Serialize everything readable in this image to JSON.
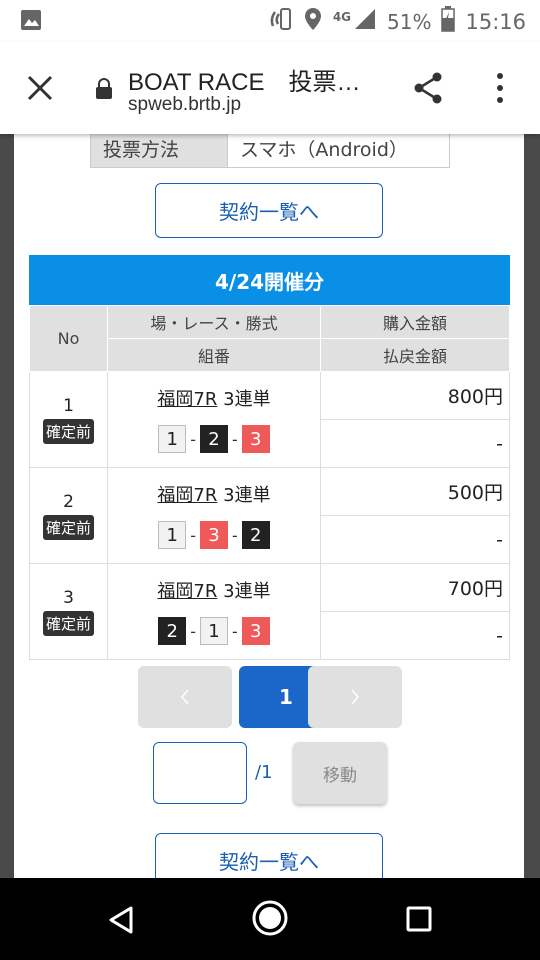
{
  "status_bar": {
    "network": "4G",
    "battery": "51%",
    "time": "15:16"
  },
  "app_bar": {
    "title": "BOAT RACE　投票…",
    "url": "spweb.brtb.jp"
  },
  "vote_method": {
    "label": "投票方法",
    "value": "スマホ（Android）"
  },
  "contract_list_button": "契約一覧へ",
  "date_header": "4/24開催分",
  "table": {
    "headers": {
      "no": "No",
      "race": "場・レース・勝式",
      "purchase": "購入金額",
      "combo": "組番",
      "payout": "払戻金額"
    },
    "rows": [
      {
        "no": "1",
        "status": "確定前",
        "venue": "福岡7R",
        "bet_type": "3連単",
        "combo": [
          {
            "n": "1",
            "c": "white"
          },
          {
            "n": "2",
            "c": "black"
          },
          {
            "n": "3",
            "c": "red"
          }
        ],
        "purchase": "800円",
        "payout": "-"
      },
      {
        "no": "2",
        "status": "確定前",
        "venue": "福岡7R",
        "bet_type": "3連単",
        "combo": [
          {
            "n": "1",
            "c": "white"
          },
          {
            "n": "3",
            "c": "red"
          },
          {
            "n": "2",
            "c": "black"
          }
        ],
        "purchase": "500円",
        "payout": "-"
      },
      {
        "no": "3",
        "status": "確定前",
        "venue": "福岡7R",
        "bet_type": "3連単",
        "combo": [
          {
            "n": "2",
            "c": "black"
          },
          {
            "n": "1",
            "c": "white"
          },
          {
            "n": "3",
            "c": "red"
          }
        ],
        "purchase": "700円",
        "payout": "-"
      }
    ]
  },
  "pagination": {
    "current": "1",
    "total": "/1",
    "move_label": "移動",
    "input_value": ""
  },
  "colors": {
    "header_blue": "#0a8fe6",
    "link_blue": "#1b5fb3",
    "chip_red": "#ee5a5a"
  }
}
